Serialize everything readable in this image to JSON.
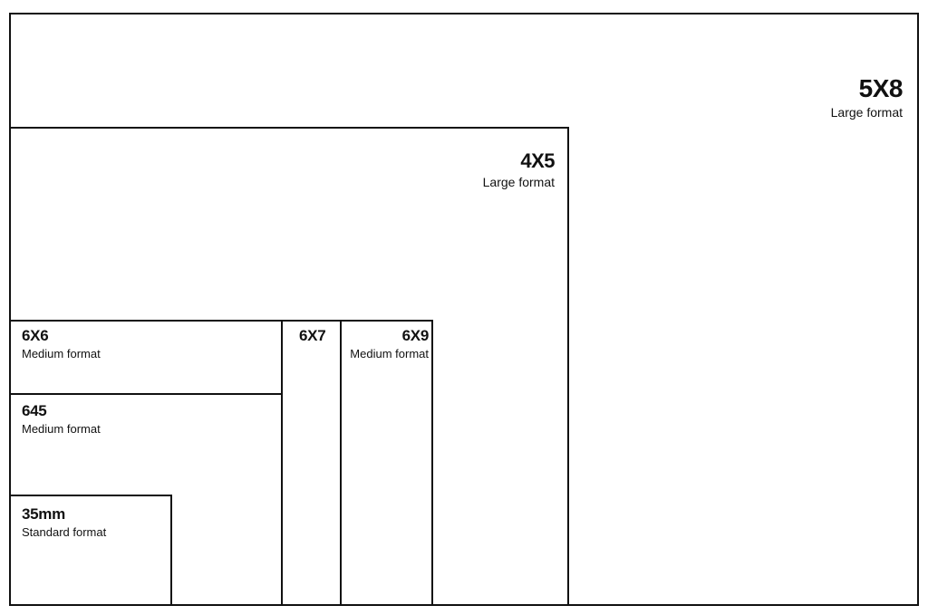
{
  "formats": {
    "f5x8": {
      "title": "5X8",
      "subtitle": "Large format"
    },
    "f4x5": {
      "title": "4X5",
      "subtitle": "Large format"
    },
    "f6x6": {
      "title": "6X6",
      "subtitle": "Medium format"
    },
    "f6x7": {
      "title": "6X7"
    },
    "f6x9": {
      "title": "6X9",
      "subtitle": "Medium format"
    },
    "f645": {
      "title": "645",
      "subtitle": "Medium format"
    },
    "f35mm": {
      "title": "35mm",
      "subtitle": "Standard format"
    }
  }
}
